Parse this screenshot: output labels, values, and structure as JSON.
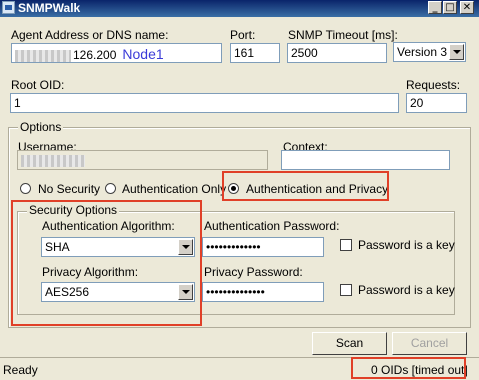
{
  "window": {
    "title": "SNMPWalk",
    "minimize_glyph": "_",
    "maximize_glyph": "□",
    "close_glyph": "✕"
  },
  "agent": {
    "label": "Agent Address or DNS name:",
    "value_visible": "126.200",
    "annotation": "Node1"
  },
  "port": {
    "label": "Port:",
    "value": "161"
  },
  "timeout": {
    "label": "SNMP Timeout [ms]:",
    "value": "2500"
  },
  "version": {
    "selected": "Version 3"
  },
  "root_oid": {
    "label": "Root OID:",
    "value": "1"
  },
  "requests": {
    "label": "Requests:",
    "value": "20"
  },
  "options": {
    "title": "Options",
    "username_label": "Username:",
    "context_label": "Context:",
    "context_value": "",
    "security_levels": [
      {
        "label": "No Security",
        "checked": false
      },
      {
        "label": "Authentication Only",
        "checked": false
      },
      {
        "label": "Authentication and Privacy",
        "checked": true
      }
    ]
  },
  "security_options": {
    "title": "Security Options",
    "auth_algorithm_label": "Authentication Algorithm:",
    "auth_algorithm_value": "SHA",
    "auth_password_label": "Authentication Password:",
    "auth_password_value": "•••••••••••••",
    "auth_key_label": "Password is a key",
    "privacy_algorithm_label": "Privacy Algorithm:",
    "privacy_algorithm_value": "AES256",
    "privacy_password_label": "Privacy Password:",
    "privacy_password_value": "••••••••••••••",
    "privacy_key_label": "Password is a key"
  },
  "buttons": {
    "scan": "Scan",
    "cancel": "Cancel"
  },
  "status": {
    "left": "Ready",
    "right": "0 OIDs [timed out]"
  },
  "colors": {
    "highlight_red": "#e04028",
    "annotation_blue": "#3a3ad8",
    "titlebar": "#0a246a"
  },
  "icons": {
    "app": "snmpwalk-app-icon",
    "combo_arrow": "chevron-down-icon"
  }
}
